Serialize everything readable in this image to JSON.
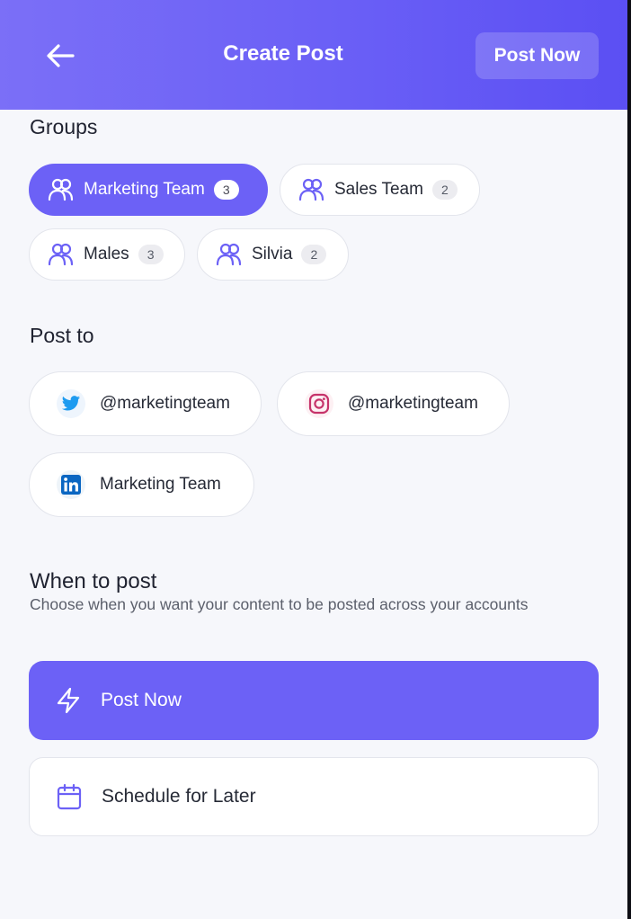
{
  "header": {
    "title": "Create Post",
    "post_now_label": "Post Now"
  },
  "groups": {
    "title": "Groups",
    "items": [
      {
        "label": "Marketing Team",
        "count": "3",
        "selected": true
      },
      {
        "label": "Sales Team",
        "count": "2",
        "selected": false
      },
      {
        "label": "Males",
        "count": "3",
        "selected": false
      },
      {
        "label": "Silvia",
        "count": "2",
        "selected": false
      }
    ]
  },
  "post_to": {
    "title": "Post to",
    "accounts": [
      {
        "platform": "twitter-icon",
        "label": "@marketingteam"
      },
      {
        "platform": "instagram-icon",
        "label": "@marketingteam"
      },
      {
        "platform": "linkedin-icon",
        "label": "Marketing Team"
      }
    ]
  },
  "when": {
    "title": "When to post",
    "subtitle": "Choose when you want your content to be posted across your accounts",
    "options": [
      {
        "icon": "lightning-icon",
        "label": "Post Now",
        "selected": true
      },
      {
        "icon": "calendar-icon",
        "label": "Schedule for Later",
        "selected": false
      }
    ]
  },
  "colors": {
    "accent": "#6c61f6",
    "header_start": "#7b6ff7",
    "header_end": "#5b4ff3",
    "background": "#f6f7fb"
  }
}
